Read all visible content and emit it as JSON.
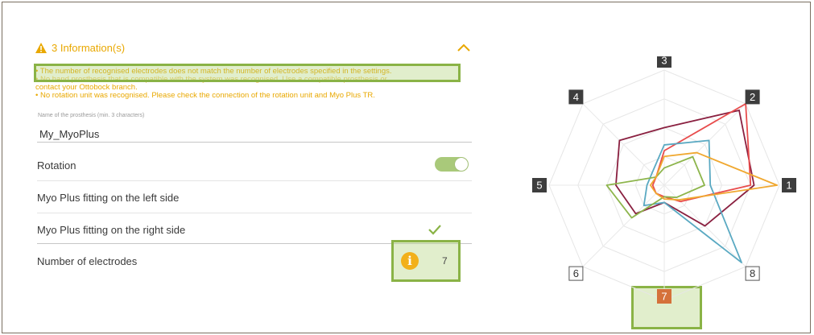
{
  "info_panel": {
    "header": "3 Information(s)",
    "messages": [
      "• The number of recognised electrodes does not match the number of electrodes specified in the settings.",
      "• No hand prosthesis that is compatible with the system was recognised. Use a compatible prosthesis or",
      "contact your Ottobock branch.",
      "• No rotation unit was recognised. Please check the connection of the rotation unit and Myo Plus TR."
    ]
  },
  "prosthesis_name": {
    "label": "Name of the prosthesis (min. 3 characters)",
    "value": "My_MyoPlus"
  },
  "settings": {
    "rotation_label": "Rotation",
    "rotation_on": true,
    "left_side_label": "Myo Plus fitting on the left side",
    "right_side_label": "Myo Plus fitting on the right side",
    "right_side_selected": true,
    "electrodes_label": "Number of electrodes",
    "electrodes_value": "7",
    "info_glyph": "i"
  },
  "radar": {
    "labels": [
      "1",
      "2",
      "3",
      "4",
      "5",
      "6",
      "7",
      "8"
    ],
    "active_labels": [
      "1",
      "2",
      "3",
      "4",
      "5"
    ],
    "inactive_labels": [
      "6",
      "8"
    ],
    "missing_label": "7",
    "colors": {
      "active_label_bg": "#3d3d3d",
      "missing_label_bg": "#d5713a",
      "highlight": "#8ab346",
      "warning": "#e9a800"
    }
  },
  "chart_data": {
    "type": "radar",
    "categories": [
      "1",
      "2",
      "3",
      "4",
      "5",
      "6",
      "7",
      "8"
    ],
    "rmax": 1,
    "series": [
      {
        "color": "#8a2040",
        "values": [
          0.78,
          0.92,
          0.5,
          0.55,
          0.42,
          0.35,
          0.15,
          0.5
        ]
      },
      {
        "color": "#e84c4c",
        "values": [
          0.75,
          1.0,
          0.3,
          0.1,
          0.1,
          0.1,
          0.1,
          0.2
        ]
      },
      {
        "color": "#5aa9c2",
        "values": [
          0.4,
          0.55,
          0.35,
          0.15,
          0.15,
          0.25,
          0.15,
          0.95
        ]
      },
      {
        "color": "#8db54c",
        "values": [
          0.35,
          0.35,
          0.15,
          0.1,
          0.5,
          0.4,
          0.1,
          0.15
        ]
      },
      {
        "color": "#f0a830",
        "values": [
          0.98,
          0.4,
          0.25,
          0.1,
          0.12,
          0.1,
          0.12,
          0.18
        ]
      }
    ]
  }
}
